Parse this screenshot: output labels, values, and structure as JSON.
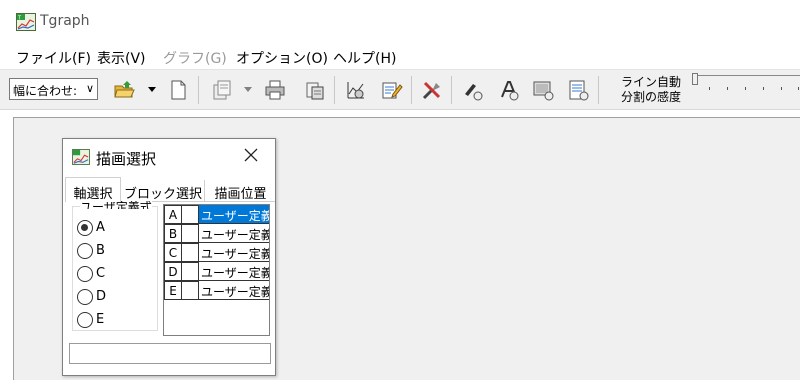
{
  "window": {
    "title": "Tgraph",
    "icon": "tgraph-app-icon"
  },
  "menu": [
    {
      "label": "ファイル(F)",
      "enabled": true
    },
    {
      "label": "表示(V)",
      "enabled": true
    },
    {
      "label": "グラフ(G)",
      "enabled": false
    },
    {
      "label": "オプション(O)",
      "enabled": true
    },
    {
      "label": "ヘルプ(H)",
      "enabled": true
    }
  ],
  "toolbar": {
    "zoom_select": "幅に合わせ:",
    "buttons": [
      "open-folder-icon",
      "dropdown-arrow-icon",
      "new-document-icon",
      "copy-pages-icon",
      "dropdown-arrow-icon",
      "print-icon",
      "clipboard-copy-icon",
      "graph-settings-icon",
      "edit-note-icon",
      "tools-icon",
      "pen-draw-icon",
      "font-settings-icon",
      "display-settings-icon",
      "report-icon"
    ],
    "slider": {
      "label_line1": "ライン自動",
      "label_line2": "分割の感度",
      "value": 0
    }
  },
  "dialog": {
    "title": "描画選択",
    "icon": "tgraph-app-icon",
    "close": "close-icon",
    "tabs": [
      {
        "label": "軸選択",
        "active": true
      },
      {
        "label": "ブロック選択",
        "active": false
      },
      {
        "label": "描画位置",
        "active": false
      }
    ],
    "axis_group": {
      "label": "ユーザ定義式",
      "options": [
        {
          "label": "A",
          "checked": true
        },
        {
          "label": "B",
          "checked": false
        },
        {
          "label": "C",
          "checked": false
        },
        {
          "label": "D",
          "checked": false
        },
        {
          "label": "E",
          "checked": false
        }
      ]
    },
    "axis_list": [
      {
        "key": "A",
        "value": "ユーザー定義",
        "selected": true
      },
      {
        "key": "B",
        "value": "ユーザー定義",
        "selected": false
      },
      {
        "key": "C",
        "value": "ユーザー定義",
        "selected": false
      },
      {
        "key": "D",
        "value": "ユーザー定義",
        "selected": false
      },
      {
        "key": "E",
        "value": "ユーザー定義",
        "selected": false
      }
    ],
    "status_text": ""
  },
  "colors": {
    "selection": "#0078d7",
    "canvas": "#f0f0f0",
    "toolbar": "#f0f0f0"
  }
}
